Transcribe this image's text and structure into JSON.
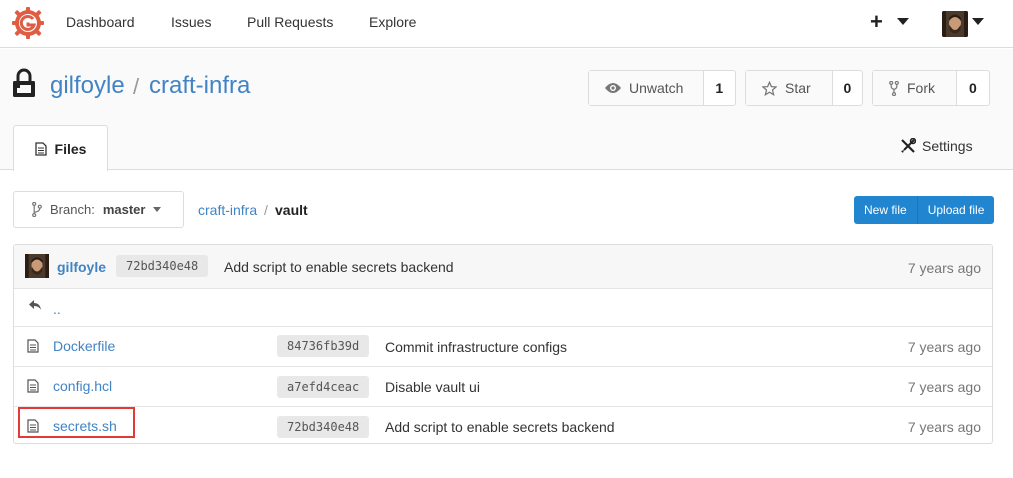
{
  "nav": {
    "items": [
      "Dashboard",
      "Issues",
      "Pull Requests",
      "Explore"
    ],
    "plus_label": "+"
  },
  "repo": {
    "owner": "gilfoyle",
    "separator": "/",
    "name": "craft-infra",
    "watch": {
      "label": "Unwatch",
      "count": "1"
    },
    "star": {
      "label": "Star",
      "count": "0"
    },
    "fork": {
      "label": "Fork",
      "count": "0"
    }
  },
  "tabs": {
    "files": "Files",
    "settings": "Settings"
  },
  "branch": {
    "prefix": "Branch:",
    "name": "master"
  },
  "breadcrumb": {
    "root": "craft-infra",
    "separator": "/",
    "current": "vault"
  },
  "actions": {
    "new_file": "New file",
    "upload_file": "Upload file"
  },
  "latest_commit": {
    "author": "gilfoyle",
    "sha": "72bd340e48",
    "message": "Add script to enable secrets backend",
    "age": "7 years ago"
  },
  "parent_dir": "..",
  "files": [
    {
      "name": "Dockerfile",
      "sha": "84736fb39d",
      "message": "Commit infrastructure configs",
      "age": "7 years ago"
    },
    {
      "name": "config.hcl",
      "sha": "a7efd4ceac",
      "message": "Disable vault ui",
      "age": "7 years ago"
    },
    {
      "name": "secrets.sh",
      "sha": "72bd340e48",
      "message": "Add script to enable secrets backend",
      "age": "7 years ago"
    }
  ],
  "colors": {
    "link": "#4183c4",
    "primary": "#2185d0",
    "logo": "#e05d44",
    "highlight": "#e53935"
  }
}
